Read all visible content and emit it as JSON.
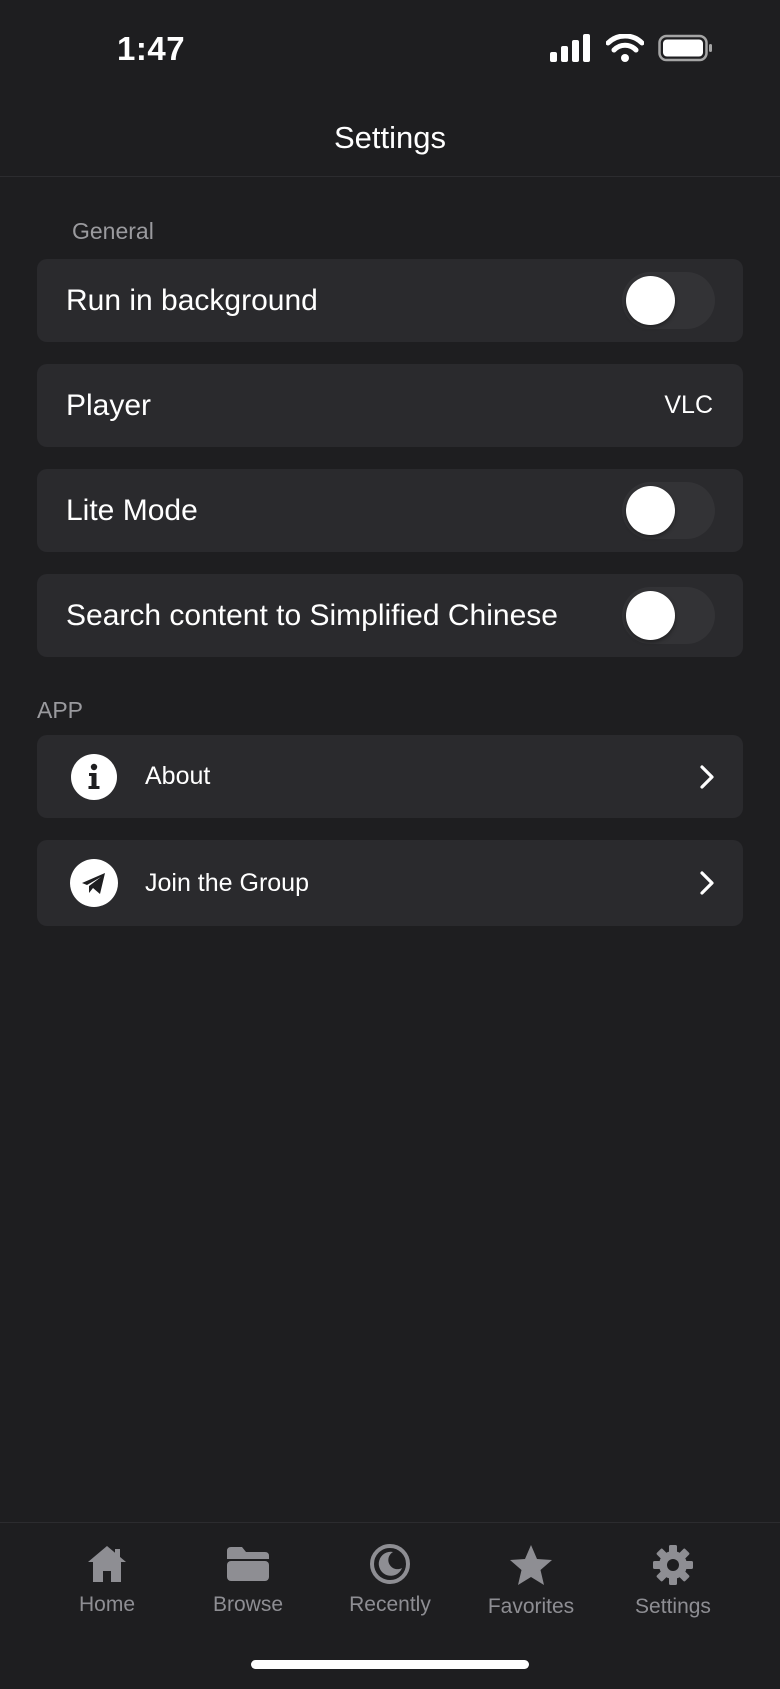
{
  "status_bar": {
    "time": "1:47"
  },
  "nav": {
    "title": "Settings"
  },
  "general": {
    "section_label": "General",
    "rows": [
      {
        "label": "Run in background",
        "toggle_on": false
      },
      {
        "label": "Player",
        "value": "VLC"
      },
      {
        "label": "Lite Mode",
        "toggle_on": false
      },
      {
        "label": "Search content to Simplified Chinese",
        "toggle_on": false
      }
    ]
  },
  "app": {
    "section_label": "APP",
    "rows": [
      {
        "label": "About",
        "icon": "info-icon"
      },
      {
        "label": "Join the Group",
        "icon": "telegram-icon"
      }
    ]
  },
  "tabs": [
    {
      "label": "Home",
      "icon": "home-icon"
    },
    {
      "label": "Browse",
      "icon": "folder-icon"
    },
    {
      "label": "Recently",
      "icon": "clock-moon-icon"
    },
    {
      "label": "Favorites",
      "icon": "star-icon"
    },
    {
      "label": "Settings",
      "icon": "gear-icon",
      "active": true
    }
  ],
  "colors": {
    "background": "#1e1e20",
    "row": "#2a2a2d",
    "muted": "#8e8e93",
    "toggle_off": "#333336"
  }
}
